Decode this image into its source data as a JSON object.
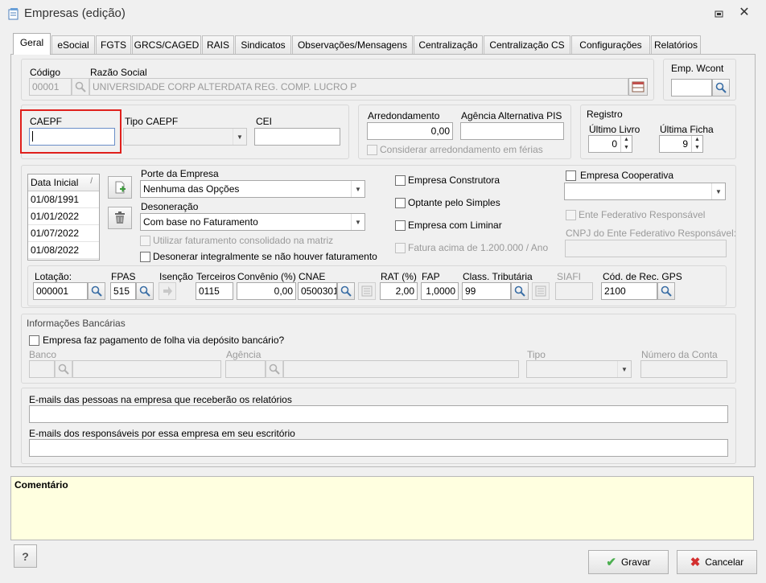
{
  "window": {
    "title": "Empresas (edição)"
  },
  "tabs": [
    "Geral",
    "eSocial",
    "FGTS",
    "GRCS/CAGED",
    "RAIS",
    "Sindicatos",
    "Observações/Mensagens",
    "Centralização",
    "Centralização CS",
    "Configurações",
    "Relatórios"
  ],
  "top": {
    "codigo_label": "Código",
    "codigo_value": "00001",
    "razao_label": "Razão Social",
    "razao_value": "UNIVERSIDADE CORP ALTERDATA REG. COMP. LUCRO P",
    "empwcont_label": "Emp. Wcont",
    "empwcont_value": ""
  },
  "caepf": {
    "caepf_label": "CAEPF",
    "caepf_value": "",
    "tipo_label": "Tipo CAEPF",
    "tipo_value": "",
    "cei_label": "CEI",
    "cei_value": ""
  },
  "arred": {
    "arred_label": "Arredondamento",
    "arred_value": "0,00",
    "agencia_label": "Agência Alternativa PIS",
    "agencia_value": "",
    "considerar_label": "Considerar arredondamento em férias"
  },
  "registro": {
    "title": "Registro",
    "livro_label": "Último Livro",
    "livro_value": "0",
    "ficha_label": "Última Ficha",
    "ficha_value": "9"
  },
  "datas": {
    "header": "Data Inicial",
    "rows": [
      "01/08/1991",
      "01/01/2022",
      "01/07/2022",
      "01/08/2022"
    ]
  },
  "porte": {
    "porte_label": "Porte da Empresa",
    "porte_value": "Nenhuma das Opções",
    "desoneracao_label": "Desoneração",
    "desoneracao_value": "Com base no Faturamento",
    "utilizar_label": "Utilizar faturamento consolidado na matriz",
    "desonerar_label": "Desonerar integralmente se não houver faturamento"
  },
  "checks": {
    "construtora": "Empresa Construtora",
    "simples": "Optante pelo Simples",
    "liminar": "Empresa com Liminar",
    "fatura": "Fatura acima de 1.200.000 / Ano",
    "cooperativa": "Empresa Cooperativa",
    "cooperativa_value": "",
    "ente_label": "Ente Federativo Responsável",
    "cnpj_ente_label": "CNPJ do Ente Federativo Responsável:",
    "cnpj_ente_value": ""
  },
  "fiscal": {
    "lotacao_label": "Lotação:",
    "lotacao_value": "000001",
    "fpas_label": "FPAS",
    "fpas_value": "515",
    "isencao_label": "Isenção",
    "terceiros_label": "Terceiros",
    "terceiros_value": "0115",
    "convenio_label": "Convênio (%)",
    "convenio_value": "0,00",
    "cnae_label": "CNAE",
    "cnae_value": "0500301",
    "rat_label": "RAT (%)",
    "rat_value": "2,00",
    "fap_label": "FAP",
    "fap_value": "1,0000",
    "class_label": "Class. Tributária",
    "class_value": "99",
    "siafi_label": "SIAFI",
    "siafi_value": "",
    "codrec_label": "Cód. de Rec. GPS",
    "codrec_value": "2100"
  },
  "banco": {
    "title": "Informações Bancárias",
    "deposito_label": "Empresa faz pagamento de folha via depósito bancário?",
    "banco_label": "Banco",
    "agencia_label": "Agência",
    "tipo_label": "Tipo",
    "conta_label": "Número da Conta"
  },
  "emails": {
    "relatorios_label": "E-mails das pessoas na empresa que receberão os relatórios",
    "responsaveis_label": "E-mails dos responsáveis por essa empresa em seu escritório"
  },
  "comentario": {
    "label": "Comentário"
  },
  "footer": {
    "help": "?",
    "gravar": "Gravar",
    "cancelar": "Cancelar"
  },
  "colors": {
    "highlight": "#e0201c",
    "comment_bg": "#ffffe0",
    "accent_green": "#4caf50",
    "accent_red": "#d32f2f"
  }
}
